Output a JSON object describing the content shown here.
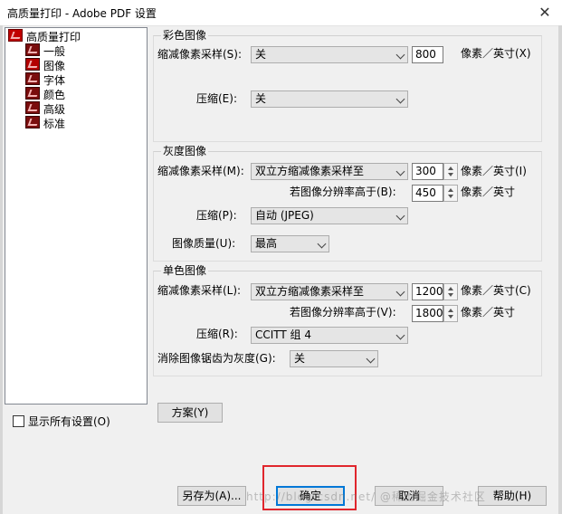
{
  "window": {
    "title": "高质量打印 - Adobe PDF 设置",
    "close_glyph": "✕"
  },
  "tree": {
    "root": "高质量打印",
    "items": [
      "一般",
      "图像",
      "字体",
      "颜色",
      "高级",
      "标准"
    ]
  },
  "show_all": {
    "label": "显示所有设置(O)",
    "checked": false
  },
  "color_images": {
    "title": "彩色图像",
    "downsample_label": "缩减像素采样(S):",
    "downsample_value": "关",
    "resolution_value": "800",
    "resolution_unit": "像素／英寸(X)",
    "compression_label": "压缩(E):",
    "compression_value": "关"
  },
  "gray_images": {
    "title": "灰度图像",
    "downsample_label": "缩减像素采样(M):",
    "downsample_value": "双立方缩减像素采样至",
    "resolution_value": "300",
    "resolution_unit": "像素／英寸(I)",
    "above_label": "若图像分辨率高于(B):",
    "above_value": "450",
    "above_unit": "像素／英寸",
    "compression_label": "压缩(P):",
    "compression_value": "自动 (JPEG)",
    "quality_label": "图像质量(U):",
    "quality_value": "最高"
  },
  "mono_images": {
    "title": "单色图像",
    "downsample_label": "缩减像素采样(L):",
    "downsample_value": "双立方缩减像素采样至",
    "resolution_value": "1200",
    "resolution_unit": "像素／英寸(C)",
    "above_label": "若图像分辨率高于(V):",
    "above_value": "1800",
    "above_unit": "像素／英寸",
    "compression_label": "压缩(R):",
    "compression_value": "CCITT 组 4",
    "antialias_label": "消除图像锯齿为灰度(G):",
    "antialias_value": "关"
  },
  "buttons": {
    "scheme": "方案(Y)",
    "save_as": "另存为(A)...",
    "ok": "确定",
    "cancel": "取消",
    "help": "帮助(H)"
  },
  "watermark": "http://blog.csdn.net/  @稀土掘金技术社区",
  "colors": {
    "accent": "#0078d7",
    "highlight": "#e0262d",
    "pdf_icon": "#7a0d0d"
  }
}
